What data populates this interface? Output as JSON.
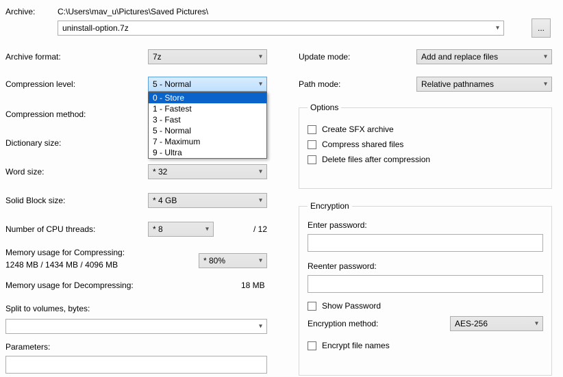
{
  "archive": {
    "label": "Archive:",
    "path": "C:\\Users\\mav_u\\Pictures\\Saved Pictures\\",
    "filename": "uninstall-option.7z",
    "browse": "..."
  },
  "left": {
    "format": {
      "label": "Archive format:",
      "value": "7z"
    },
    "level": {
      "label": "Compression level:",
      "value": "5 - Normal",
      "options": [
        "0 - Store",
        "1 - Fastest",
        "3 - Fast",
        "5 - Normal",
        "7 - Maximum",
        "9 - Ultra"
      ],
      "highlighted": "0 - Store"
    },
    "method": {
      "label": "Compression method:"
    },
    "dict": {
      "label": "Dictionary size:"
    },
    "word": {
      "label": "Word size:",
      "value": "* 32"
    },
    "solid": {
      "label": "Solid Block size:",
      "value": "* 4 GB"
    },
    "threads": {
      "label": "Number of CPU threads:",
      "value": "* 8",
      "total": "/ 12"
    },
    "mem_compress": {
      "label": "Memory usage for Compressing:",
      "detail": "1248 MB / 1434 MB / 4096 MB",
      "value": "* 80%"
    },
    "mem_decompress": {
      "label": "Memory usage for Decompressing:",
      "value": "18 MB"
    },
    "split": {
      "label": "Split to volumes, bytes:"
    },
    "params": {
      "label": "Parameters:"
    }
  },
  "right": {
    "update": {
      "label": "Update mode:",
      "value": "Add and replace files"
    },
    "path": {
      "label": "Path mode:",
      "value": "Relative pathnames"
    },
    "options": {
      "legend": "Options",
      "sfx": "Create SFX archive",
      "shared": "Compress shared files",
      "delete": "Delete files after compression"
    },
    "encryption": {
      "legend": "Encryption",
      "enter": "Enter password:",
      "reenter": "Reenter password:",
      "show": "Show Password",
      "method_label": "Encryption method:",
      "method_value": "AES-256",
      "encrypt_names": "Encrypt file names"
    }
  }
}
